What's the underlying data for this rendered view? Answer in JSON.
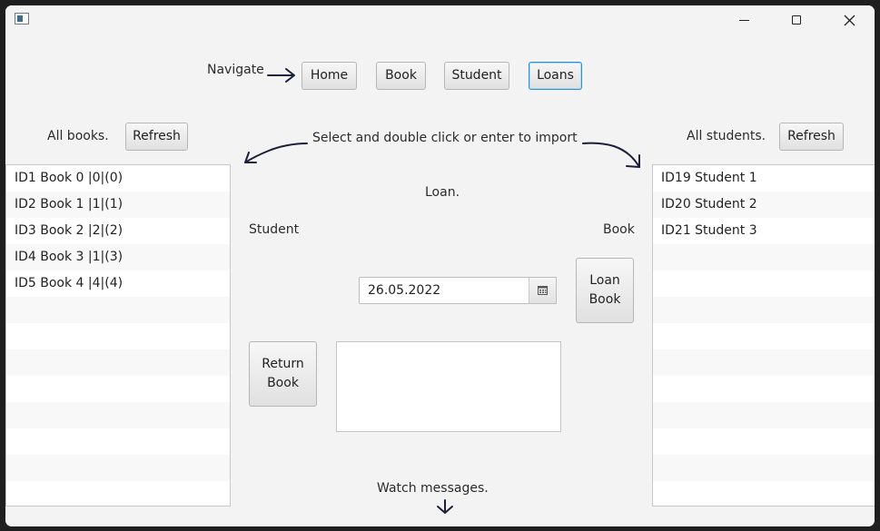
{
  "navigation": {
    "label": "Navigate",
    "buttons": [
      "Home",
      "Book",
      "Student",
      "Loans"
    ],
    "active": "Loans"
  },
  "books_panel": {
    "title": "All books.",
    "refresh_label": "Refresh",
    "items": [
      "ID1 Book 0 |0|(0)",
      "ID2 Book 1 |1|(1)",
      "ID3 Book 2 |2|(2)",
      "ID4 Book 3 |1|(3)",
      "ID5 Book 4 |4|(4)"
    ]
  },
  "students_panel": {
    "title": "All students.",
    "refresh_label": "Refresh",
    "items": [
      "ID19 Student 1",
      "ID20 Student 2",
      "ID21 Student 3"
    ]
  },
  "loan": {
    "instruction": "Select and double click or enter to import",
    "heading": "Loan.",
    "student_label": "Student",
    "book_label": "Book",
    "date_value": "26.05.2022",
    "loan_book_label": [
      "Loan",
      "Book"
    ],
    "return_book_label": [
      "Return",
      "Book"
    ],
    "messages_label": "Watch messages."
  },
  "colors": {
    "accent_border": "#2a8fd6",
    "window_bg": "#f3f3f3",
    "arrow": "#1b1f3a"
  }
}
